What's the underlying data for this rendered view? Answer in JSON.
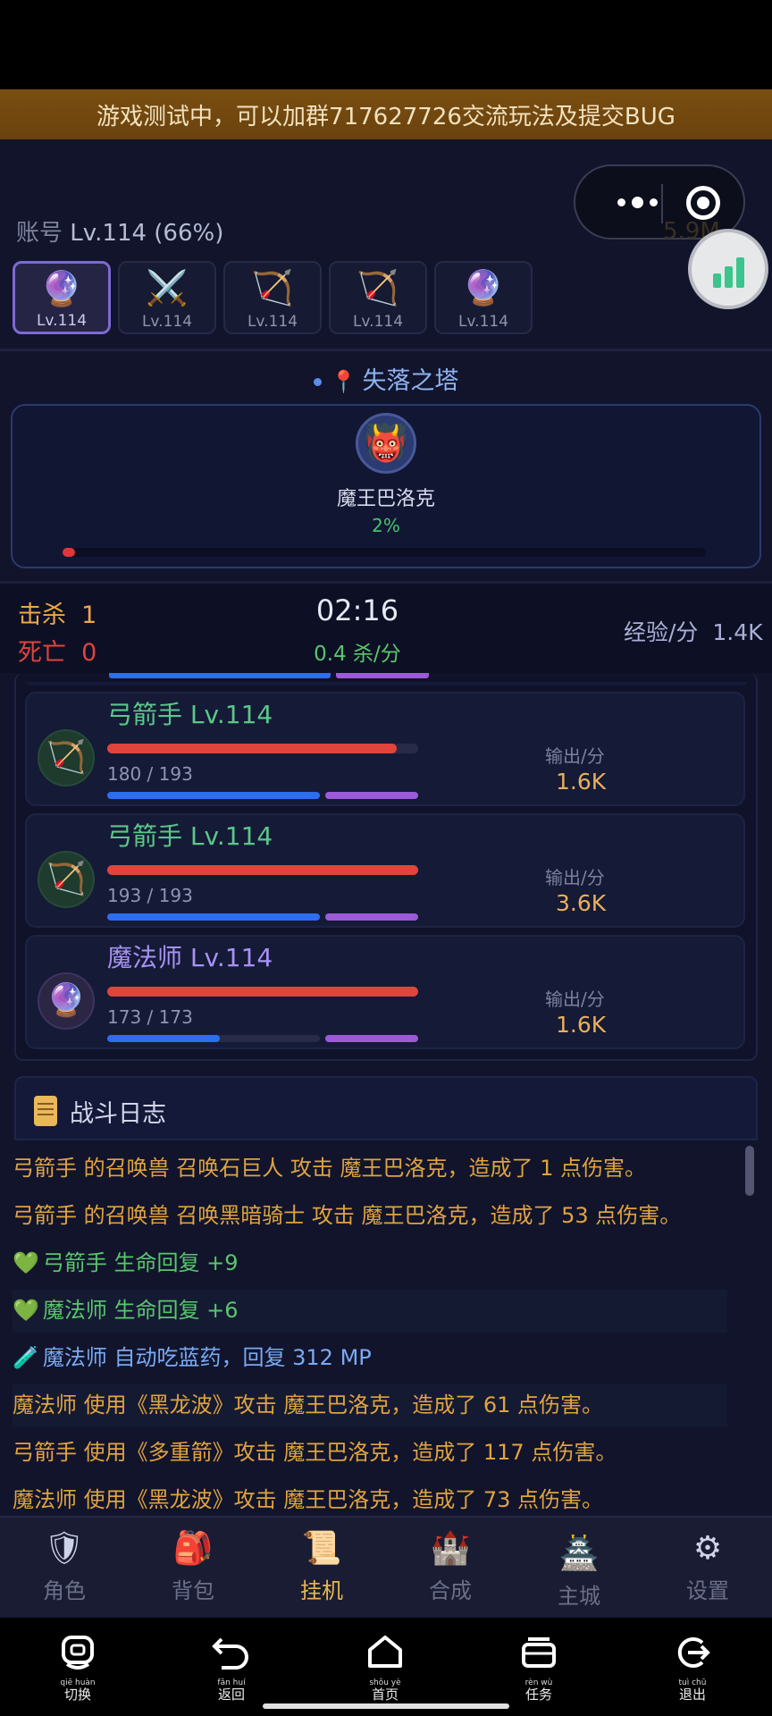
{
  "banner": {
    "text": "游戏测试中，可以加群717627726交流玩法及提交BUG"
  },
  "capsule": {
    "menu_icon": "more-dots-icon",
    "close_icon": "target-circle-icon"
  },
  "gold": {
    "value": "5.9M"
  },
  "account": {
    "label": "账号",
    "level": "Lv.114 (66%)"
  },
  "roster": [
    {
      "icon": "crystal-ball-icon",
      "glyph": "🔮",
      "level": "Lv.114",
      "active": true
    },
    {
      "icon": "crossed-swords-icon",
      "glyph": "⚔️",
      "level": "Lv.114",
      "active": false
    },
    {
      "icon": "bow-arrow-icon",
      "glyph": "🏹",
      "level": "Lv.114",
      "active": false
    },
    {
      "icon": "bow-arrow-icon",
      "glyph": "🏹",
      "level": "Lv.114",
      "active": false
    },
    {
      "icon": "crystal-ball-icon",
      "glyph": "🔮",
      "level": "Lv.114",
      "active": false
    }
  ],
  "location": {
    "name": "失落之塔"
  },
  "boss": {
    "name": "魔王巴洛克",
    "progress_text": "2%",
    "progress": 0.02,
    "avatar_glyph": "👹"
  },
  "combat": {
    "kills_label": "击杀",
    "kills": "1",
    "deaths_label": "死亡",
    "deaths": "0",
    "timer": "02:16",
    "kills_per_min": "0.4 杀/分",
    "exp_label": "经验/分",
    "exp": "1.4K"
  },
  "party": [
    {
      "name": "弓箭手 Lv.114",
      "class": "archer",
      "glyph": "🏹",
      "hp_text": "180 / 193",
      "hp": 0.93,
      "mp": 1.0,
      "output_label": "输出/分",
      "output": "1.6K"
    },
    {
      "name": "弓箭手 Lv.114",
      "class": "archer",
      "glyph": "🏹",
      "hp_text": "193 / 193",
      "hp": 1.0,
      "mp": 1.0,
      "output_label": "输出/分",
      "output": "3.6K"
    },
    {
      "name": "魔法师 Lv.114",
      "class": "mage",
      "glyph": "🔮",
      "hp_text": "173 / 173",
      "hp": 1.0,
      "mp": 0.53,
      "output_label": "输出/分",
      "output": "1.6K"
    }
  ],
  "log": {
    "title": "战斗日志",
    "lines": [
      {
        "text": "弓箭手 的召唤兽 召唤石巨人 攻击 魔王巴洛克，造成了 1 点伤害。",
        "kind": "damage",
        "prefix": ""
      },
      {
        "text": "弓箭手 的召唤兽 召唤黑暗骑士 攻击 魔王巴洛克，造成了 53 点伤害。",
        "kind": "damage",
        "prefix": ""
      },
      {
        "text": "弓箭手 生命回复 +9",
        "kind": "heal",
        "prefix": "💚"
      },
      {
        "text": "魔法师 生命回复 +6",
        "kind": "heal",
        "prefix": "💚"
      },
      {
        "text": "魔法师 自动吃蓝药，回复 312 MP",
        "kind": "mana",
        "prefix": "🧪"
      },
      {
        "text": "魔法师 使用《黑龙波》攻击 魔王巴洛克，造成了 61 点伤害。",
        "kind": "damage",
        "prefix": ""
      },
      {
        "text": "弓箭手 使用《多重箭》攻击 魔王巴洛克，造成了 117 点伤害。",
        "kind": "damage",
        "prefix": ""
      },
      {
        "text": "魔法师 使用《黑龙波》攻击 魔王巴洛克，造成了 73 点伤害。",
        "kind": "damage",
        "prefix": ""
      }
    ]
  },
  "tabs": [
    {
      "label": "角色",
      "icon": "character-icon",
      "glyph": "🛡",
      "active": false
    },
    {
      "label": "背包",
      "icon": "backpack-icon",
      "glyph": "🎒",
      "active": false
    },
    {
      "label": "挂机",
      "icon": "scroll-icon",
      "glyph": "📜",
      "active": true
    },
    {
      "label": "合成",
      "icon": "castle-icon",
      "glyph": "🏰",
      "active": false
    },
    {
      "label": "主城",
      "icon": "city-icon",
      "glyph": "🏯",
      "active": false
    },
    {
      "label": "设置",
      "icon": "gear-icon",
      "glyph": "⚙",
      "active": false
    }
  ],
  "system_nav": [
    {
      "pinyin": "qiē huàn",
      "label": "切换",
      "icon": "switch-icon"
    },
    {
      "pinyin": "fǎn huí",
      "label": "返回",
      "icon": "back-icon"
    },
    {
      "pinyin": "shǒu yè",
      "label": "首页",
      "icon": "home-icon"
    },
    {
      "pinyin": "rèn wù",
      "label": "任务",
      "icon": "tasks-icon"
    },
    {
      "pinyin": "tuì chū",
      "label": "退出",
      "icon": "exit-icon"
    }
  ]
}
